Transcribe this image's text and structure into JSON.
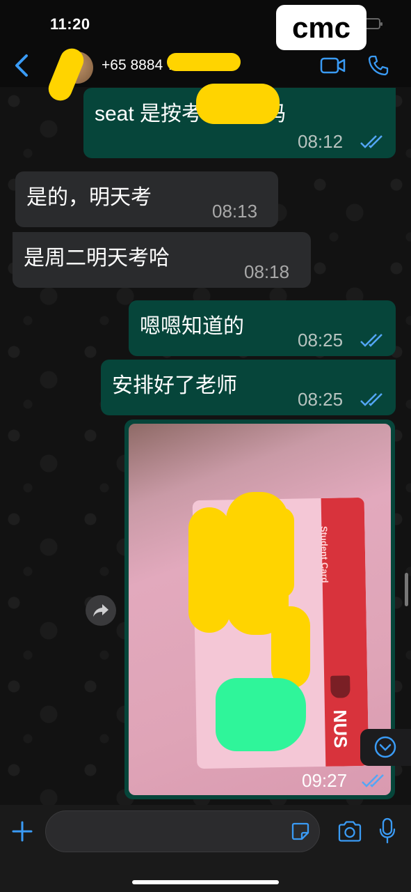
{
  "status_bar": {
    "time": "11:20",
    "overlay_label": "cmc"
  },
  "header": {
    "contact_number": "+65 8884 7257"
  },
  "messages": [
    {
      "text": "seat 是按考号座对吗",
      "time": "08:12"
    },
    {
      "text": "是的，明天考",
      "time": "08:13"
    },
    {
      "text": "是周二明天考哈",
      "time": "08:18"
    },
    {
      "text": "嗯嗯知道的",
      "time": "08:25"
    },
    {
      "text": "安排好了老师",
      "time": "08:25"
    }
  ],
  "image_message": {
    "time": "09:27",
    "card_label": "Student Card",
    "card_logo": "NUS"
  },
  "composer": {
    "placeholder": ""
  },
  "icons": [
    "back-chevron-icon",
    "video-call-icon",
    "phone-icon",
    "read-ticks-icon",
    "forward-icon",
    "scroll-down-icon",
    "plus-icon",
    "sticker-icon",
    "camera-icon",
    "microphone-icon"
  ],
  "colors": {
    "accent": "#3a9bf5",
    "outgoing_bubble": "#06453a",
    "incoming_bubble": "#2a2b2d",
    "read_ticks": "#53a6f5"
  }
}
